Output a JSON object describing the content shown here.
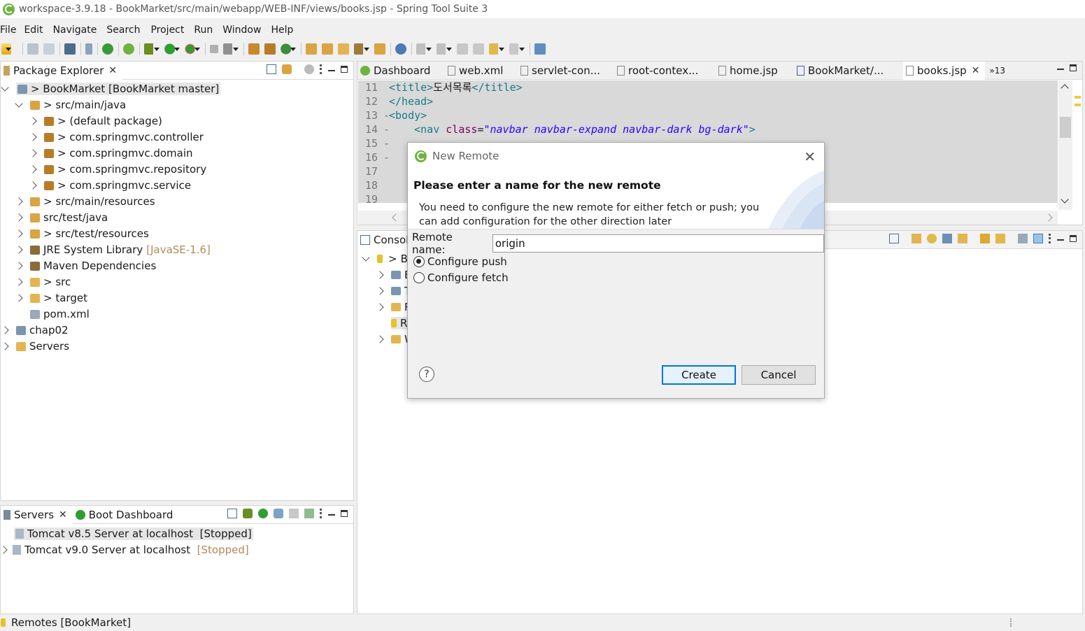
{
  "window": {
    "title": "workspace-3.9.18 - BookMarket/src/main/webapp/WEB-INF/views/books.jsp - Spring Tool Suite 3"
  },
  "menu": [
    "File",
    "Edit",
    "Navigate",
    "Search",
    "Project",
    "Run",
    "Window",
    "Help"
  ],
  "package_explorer": {
    "tab_label": "Package Explorer",
    "items": [
      {
        "label": "> BookMarket [BookMarket master]",
        "icon": "project-icon",
        "state": "open",
        "depth": 0,
        "selected": true
      },
      {
        "label": "> src/main/java",
        "icon": "source-folder-icon",
        "state": "open",
        "depth": 1
      },
      {
        "label": "> (default package)",
        "icon": "package-icon",
        "state": "closed",
        "depth": 2
      },
      {
        "label": "> com.springmvc.controller",
        "icon": "package-icon",
        "state": "closed",
        "depth": 2
      },
      {
        "label": "> com.springmvc.domain",
        "icon": "package-icon",
        "state": "closed",
        "depth": 2
      },
      {
        "label": "> com.springmvc.repository",
        "icon": "package-icon",
        "state": "closed",
        "depth": 2
      },
      {
        "label": "> com.springmvc.service",
        "icon": "package-icon",
        "state": "closed",
        "depth": 2
      },
      {
        "label": "> src/main/resources",
        "icon": "source-folder-icon",
        "state": "closed",
        "depth": 1
      },
      {
        "label": "src/test/java",
        "icon": "source-folder-icon",
        "state": "closed",
        "depth": 1
      },
      {
        "label": "> src/test/resources",
        "icon": "source-folder-icon",
        "state": "closed",
        "depth": 1
      },
      {
        "label": "JRE System Library",
        "suffix": "[JavaSE-1.6]",
        "icon": "library-icon",
        "state": "closed",
        "depth": 1
      },
      {
        "label": "Maven Dependencies",
        "icon": "library-icon",
        "state": "closed",
        "depth": 1
      },
      {
        "label": "> src",
        "icon": "folder-icon",
        "state": "closed",
        "depth": 1
      },
      {
        "label": "> target",
        "icon": "folder-icon",
        "state": "closed",
        "depth": 1
      },
      {
        "label": "pom.xml",
        "icon": "xml-file-icon",
        "state": "none",
        "depth": 1
      },
      {
        "label": "chap02",
        "icon": "project-icon",
        "state": "closed",
        "depth": 0
      },
      {
        "label": "Servers",
        "icon": "folder-icon",
        "state": "closed",
        "depth": 0
      }
    ]
  },
  "servers_view": {
    "tabs": [
      "Servers",
      "Boot Dashboard"
    ],
    "items": [
      {
        "label": "Tomcat v8.5 Server at localhost",
        "status": "[Stopped]",
        "selected": true
      },
      {
        "label": "Tomcat v9.0 Server at localhost",
        "status": "[Stopped]",
        "selected": false
      }
    ]
  },
  "editor": {
    "tabs": [
      "Dashboard",
      "web.xml",
      "servlet-con...",
      "root-contex...",
      "home.jsp",
      "BookMarket/...",
      "books.jsp"
    ],
    "overflow": "»13",
    "lines": [
      {
        "n": "11",
        "marker": "",
        "parts": [
          [
            "tag",
            "<title>"
          ],
          [
            "text",
            "도서목록"
          ],
          [
            "tag",
            "</title>"
          ]
        ]
      },
      {
        "n": "12",
        "marker": "",
        "parts": [
          [
            "tag",
            "</head>"
          ]
        ]
      },
      {
        "n": "13",
        "marker": "-",
        "parts": [
          [
            "tag",
            "<body>"
          ]
        ]
      },
      {
        "n": "14",
        "marker": "-",
        "parts": [
          [
            "text",
            "    "
          ],
          [
            "tag",
            "<nav "
          ],
          [
            "attr",
            "class"
          ],
          [
            "text",
            "="
          ],
          [
            "val",
            "\"navbar navbar-expand navbar-dark bg-dark\""
          ],
          [
            "tag",
            ">"
          ]
        ]
      },
      {
        "n": "15",
        "marker": "-",
        "parts": []
      },
      {
        "n": "16",
        "marker": "-",
        "parts": []
      },
      {
        "n": "17",
        "marker": "",
        "parts": []
      },
      {
        "n": "18",
        "marker": "",
        "parts": []
      },
      {
        "n": "19",
        "marker": "",
        "parts": []
      }
    ]
  },
  "lower_view": {
    "tab_label": "Consol",
    "items": [
      {
        "label": "Bo",
        "state": "open"
      },
      {
        "label": "B",
        "state": "closed"
      },
      {
        "label": "T",
        "state": "closed"
      },
      {
        "label": "R",
        "state": "closed"
      },
      {
        "label": "R",
        "state": "none"
      },
      {
        "label": "W",
        "state": "closed"
      }
    ]
  },
  "dialog": {
    "title": "New Remote",
    "heading": "Please enter a name for the new remote",
    "message": "You need to configure the new remote for either fetch or push; you can add configuration for the other direction later",
    "remote_name_label": "Remote name:",
    "remote_name_value": "origin",
    "options": [
      {
        "label": "Configure push",
        "checked": true
      },
      {
        "label": "Configure fetch",
        "checked": false
      }
    ],
    "create_label": "Create",
    "cancel_label": "Cancel",
    "help_glyph": "?"
  },
  "status": {
    "text": "Remotes [BookMarket]"
  },
  "colors": {
    "spring_green": "#6db33f",
    "decoration": "#7a8a99",
    "tag": "#1a7a8a",
    "attr": "#7f0055",
    "string": "#2a00ff",
    "stopped": "#b08a5a",
    "focus_blue": "#0078d7"
  }
}
